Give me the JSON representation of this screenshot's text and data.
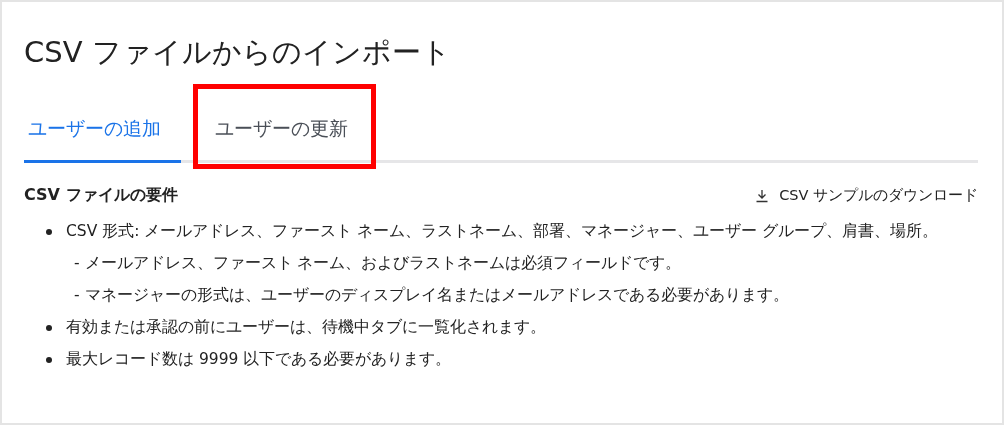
{
  "dialog": {
    "title": "CSV ファイルからのインポート"
  },
  "tabs": [
    {
      "label": "ユーザーの追加",
      "selected": true,
      "highlighted": false
    },
    {
      "label": "ユーザーの更新",
      "selected": false,
      "highlighted": true
    }
  ],
  "requirements": {
    "heading": "CSV ファイルの要件",
    "download_link": "CSV サンプルのダウンロード",
    "items": [
      {
        "kind": "bullet",
        "text": "CSV 形式: メールアドレス、ファースト ネーム、ラストネーム、部署、マネージャー、ユーザー グループ、肩書、場所。"
      },
      {
        "kind": "note",
        "text": "- メールアドレス、ファースト ネーム、およびラストネームは必須フィールドです。"
      },
      {
        "kind": "note",
        "text": "- マネージャーの形式は、ユーザーのディスプレイ名またはメールアドレスである必要があります。"
      },
      {
        "kind": "bullet",
        "text": "有効または承認の前にユーザーは、待機中タブに一覧化されます。"
      },
      {
        "kind": "bullet",
        "text": "最大レコード数は 9999 以下である必要があります。"
      }
    ]
  }
}
